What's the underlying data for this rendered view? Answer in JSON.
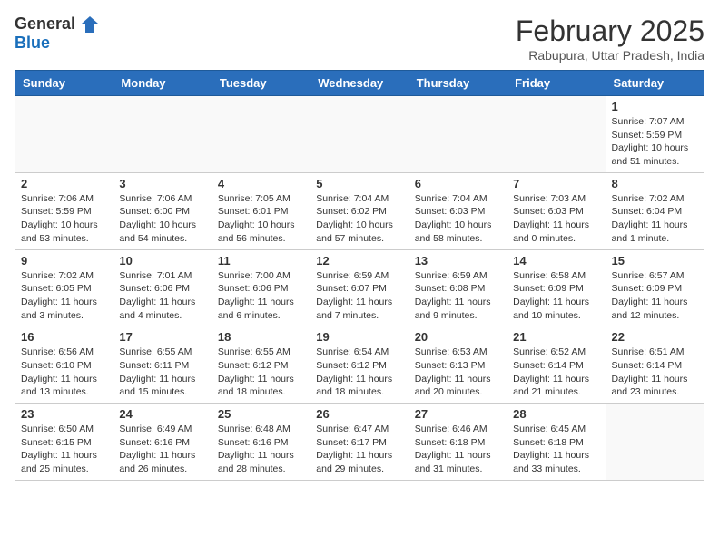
{
  "header": {
    "logo_general": "General",
    "logo_blue": "Blue",
    "title": "February 2025",
    "subtitle": "Rabupura, Uttar Pradesh, India"
  },
  "weekdays": [
    "Sunday",
    "Monday",
    "Tuesday",
    "Wednesday",
    "Thursday",
    "Friday",
    "Saturday"
  ],
  "weeks": [
    [
      {
        "day": "",
        "info": ""
      },
      {
        "day": "",
        "info": ""
      },
      {
        "day": "",
        "info": ""
      },
      {
        "day": "",
        "info": ""
      },
      {
        "day": "",
        "info": ""
      },
      {
        "day": "",
        "info": ""
      },
      {
        "day": "1",
        "info": "Sunrise: 7:07 AM\nSunset: 5:59 PM\nDaylight: 10 hours\nand 51 minutes."
      }
    ],
    [
      {
        "day": "2",
        "info": "Sunrise: 7:06 AM\nSunset: 5:59 PM\nDaylight: 10 hours\nand 53 minutes."
      },
      {
        "day": "3",
        "info": "Sunrise: 7:06 AM\nSunset: 6:00 PM\nDaylight: 10 hours\nand 54 minutes."
      },
      {
        "day": "4",
        "info": "Sunrise: 7:05 AM\nSunset: 6:01 PM\nDaylight: 10 hours\nand 56 minutes."
      },
      {
        "day": "5",
        "info": "Sunrise: 7:04 AM\nSunset: 6:02 PM\nDaylight: 10 hours\nand 57 minutes."
      },
      {
        "day": "6",
        "info": "Sunrise: 7:04 AM\nSunset: 6:03 PM\nDaylight: 10 hours\nand 58 minutes."
      },
      {
        "day": "7",
        "info": "Sunrise: 7:03 AM\nSunset: 6:03 PM\nDaylight: 11 hours\nand 0 minutes."
      },
      {
        "day": "8",
        "info": "Sunrise: 7:02 AM\nSunset: 6:04 PM\nDaylight: 11 hours\nand 1 minute."
      }
    ],
    [
      {
        "day": "9",
        "info": "Sunrise: 7:02 AM\nSunset: 6:05 PM\nDaylight: 11 hours\nand 3 minutes."
      },
      {
        "day": "10",
        "info": "Sunrise: 7:01 AM\nSunset: 6:06 PM\nDaylight: 11 hours\nand 4 minutes."
      },
      {
        "day": "11",
        "info": "Sunrise: 7:00 AM\nSunset: 6:06 PM\nDaylight: 11 hours\nand 6 minutes."
      },
      {
        "day": "12",
        "info": "Sunrise: 6:59 AM\nSunset: 6:07 PM\nDaylight: 11 hours\nand 7 minutes."
      },
      {
        "day": "13",
        "info": "Sunrise: 6:59 AM\nSunset: 6:08 PM\nDaylight: 11 hours\nand 9 minutes."
      },
      {
        "day": "14",
        "info": "Sunrise: 6:58 AM\nSunset: 6:09 PM\nDaylight: 11 hours\nand 10 minutes."
      },
      {
        "day": "15",
        "info": "Sunrise: 6:57 AM\nSunset: 6:09 PM\nDaylight: 11 hours\nand 12 minutes."
      }
    ],
    [
      {
        "day": "16",
        "info": "Sunrise: 6:56 AM\nSunset: 6:10 PM\nDaylight: 11 hours\nand 13 minutes."
      },
      {
        "day": "17",
        "info": "Sunrise: 6:55 AM\nSunset: 6:11 PM\nDaylight: 11 hours\nand 15 minutes."
      },
      {
        "day": "18",
        "info": "Sunrise: 6:55 AM\nSunset: 6:12 PM\nDaylight: 11 hours\nand 18 minutes."
      },
      {
        "day": "19",
        "info": "Sunrise: 6:54 AM\nSunset: 6:12 PM\nDaylight: 11 hours\nand 18 minutes."
      },
      {
        "day": "20",
        "info": "Sunrise: 6:53 AM\nSunset: 6:13 PM\nDaylight: 11 hours\nand 20 minutes."
      },
      {
        "day": "21",
        "info": "Sunrise: 6:52 AM\nSunset: 6:14 PM\nDaylight: 11 hours\nand 21 minutes."
      },
      {
        "day": "22",
        "info": "Sunrise: 6:51 AM\nSunset: 6:14 PM\nDaylight: 11 hours\nand 23 minutes."
      }
    ],
    [
      {
        "day": "23",
        "info": "Sunrise: 6:50 AM\nSunset: 6:15 PM\nDaylight: 11 hours\nand 25 minutes."
      },
      {
        "day": "24",
        "info": "Sunrise: 6:49 AM\nSunset: 6:16 PM\nDaylight: 11 hours\nand 26 minutes."
      },
      {
        "day": "25",
        "info": "Sunrise: 6:48 AM\nSunset: 6:16 PM\nDaylight: 11 hours\nand 28 minutes."
      },
      {
        "day": "26",
        "info": "Sunrise: 6:47 AM\nSunset: 6:17 PM\nDaylight: 11 hours\nand 29 minutes."
      },
      {
        "day": "27",
        "info": "Sunrise: 6:46 AM\nSunset: 6:18 PM\nDaylight: 11 hours\nand 31 minutes."
      },
      {
        "day": "28",
        "info": "Sunrise: 6:45 AM\nSunset: 6:18 PM\nDaylight: 11 hours\nand 33 minutes."
      },
      {
        "day": "",
        "info": ""
      }
    ]
  ]
}
